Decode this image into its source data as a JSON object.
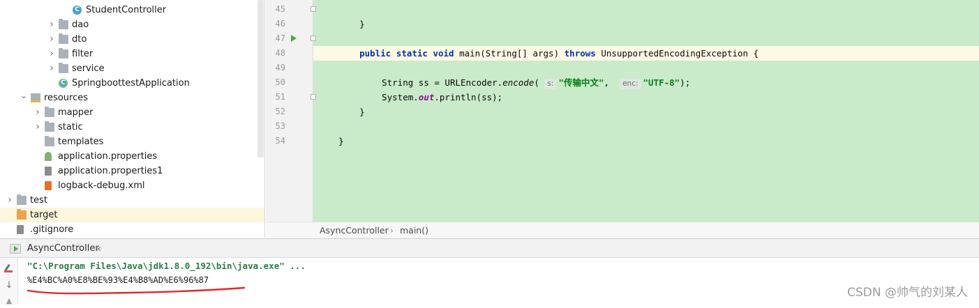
{
  "project_tree": {
    "items": [
      {
        "label": "StudentController",
        "icon": "class-icon",
        "indent": 4,
        "expandable": false
      },
      {
        "label": "dao",
        "icon": "folder-icon",
        "indent": 3,
        "expandable": true
      },
      {
        "label": "dto",
        "icon": "folder-icon",
        "indent": 3,
        "expandable": true
      },
      {
        "label": "filter",
        "icon": "folder-icon",
        "indent": 3,
        "expandable": true
      },
      {
        "label": "service",
        "icon": "folder-icon",
        "indent": 3,
        "expandable": true
      },
      {
        "label": "SpringboottestApplication",
        "icon": "spring-class-icon",
        "indent": 3,
        "expandable": false
      },
      {
        "label": "resources",
        "icon": "resources-folder-icon",
        "indent": 1,
        "expanded": true
      },
      {
        "label": "mapper",
        "icon": "folder-icon",
        "indent": 2,
        "expandable": true
      },
      {
        "label": "static",
        "icon": "folder-icon",
        "indent": 2,
        "expandable": true
      },
      {
        "label": "templates",
        "icon": "folder-icon",
        "indent": 2,
        "expandable": false
      },
      {
        "label": "application.properties",
        "icon": "spring-properties-icon",
        "indent": 2,
        "expandable": false
      },
      {
        "label": "application.properties1",
        "icon": "text-file-icon",
        "indent": 2,
        "expandable": false
      },
      {
        "label": "logback-debug.xml",
        "icon": "xml-file-icon",
        "indent": 2,
        "expandable": false
      },
      {
        "label": "test",
        "icon": "folder-icon",
        "indent": 0,
        "expandable": true
      },
      {
        "label": "target",
        "icon": "excluded-folder-icon",
        "indent": 0,
        "expandable": false,
        "selected": true
      },
      {
        "label": ".gitignore",
        "icon": "text-file-icon",
        "indent": 0,
        "expandable": false
      }
    ]
  },
  "editor": {
    "line_numbers": [
      "45",
      "46",
      "47",
      "48",
      "49",
      "50",
      "51",
      "52",
      "53",
      "54"
    ],
    "line45": "}",
    "line47": {
      "kw": "public static void",
      "sig": "main(String[] args)",
      "throws": "throws",
      "exc": "UnsupportedEncodingException {"
    },
    "line49": {
      "pre": "String ss = URLEncoder.",
      "method": "encode",
      "paren": "(",
      "hint1": "s:",
      "str1": "\"传输中文\"",
      "comma": ",",
      "hint2": "enc:",
      "str2": "\"UTF-8\"",
      "end": ");"
    },
    "line50": {
      "pre": "System.",
      "field": "out",
      "post": ".println(ss);"
    },
    "line51": "}",
    "line53": "}"
  },
  "breadcrumb": {
    "class": "AsyncController",
    "separator": "›",
    "method": "main()"
  },
  "run_panel": {
    "tab_label": "AsyncController",
    "tab_close": "×",
    "command": "\"C:\\Program Files\\Java\\jdk1.8.0_192\\bin\\java.exe\" ...",
    "output": "%E4%BC%A0%E8%BE%93%E4%B8%AD%E6%96%87",
    "sort_glyph": "↓",
    "up_glyph": "▲"
  },
  "watermark": "CSDN @帅气的刘某人",
  "colors": {
    "editor_bg": "#c9ebc9",
    "keyword": "#0033b3",
    "string": "#067d17",
    "annotation_underline": "#e0282e"
  }
}
